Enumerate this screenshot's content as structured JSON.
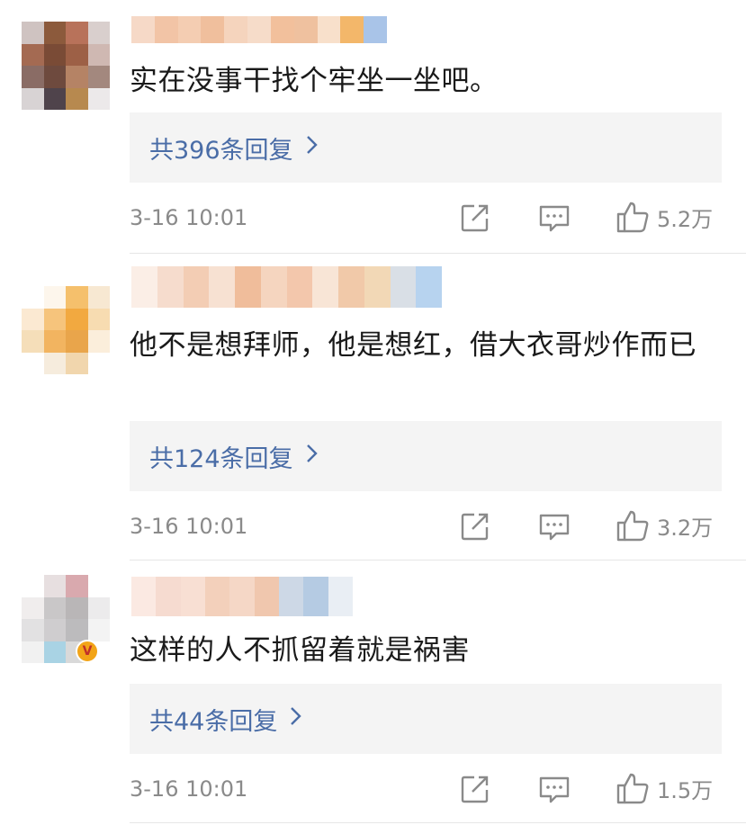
{
  "comments": [
    {
      "text": "实在没事干找个牢坐一坐吧。",
      "reply_label": "共396条回复",
      "timestamp": "3-16 10:01",
      "likes": "5.2万"
    },
    {
      "text": "他不是想拜师，他是想红，借大衣哥炒作而已",
      "reply_label": "共124条回复",
      "timestamp": "3-16 10:01",
      "likes": "3.2万"
    },
    {
      "text": "这样的人不抓留着就是祸害",
      "reply_label": "共44条回复",
      "timestamp": "3-16 10:01",
      "likes": "1.5万"
    }
  ],
  "icons": {
    "repost": "share-square-icon",
    "comment": "comment-bubble-icon",
    "like": "thumbs-up-icon",
    "chevron": "chevron-right-icon",
    "verified": "vip-verified-icon"
  },
  "colors": {
    "link": "#4a6da7",
    "muted": "#8a8a8a",
    "reply_bg": "#f4f4f4",
    "verified": "#f2a417"
  }
}
